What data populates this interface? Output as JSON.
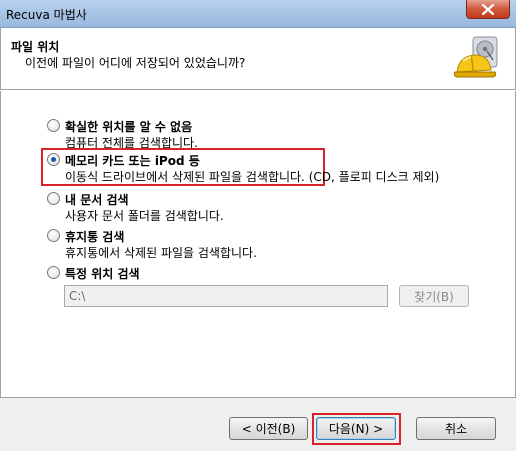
{
  "window": {
    "title": "Recuva 마법사"
  },
  "header": {
    "title": "파일 위치",
    "subtitle": "이전에 파일이 어디에 저장되어 있었습니까?"
  },
  "options": [
    {
      "title": "확실한 위치를 알 수 없음",
      "desc": "컴퓨터 전체를 검색합니다.",
      "checked": false
    },
    {
      "title": "메모리 카드 또는 iPod 등",
      "desc": "이동식 드라이브에서 삭제된 파일을 검색합니다. (CD, 플로피 디스크 제외)",
      "checked": true
    },
    {
      "title": "내 문서 검색",
      "desc": "사용자 문서 폴더를 검색합니다.",
      "checked": false
    },
    {
      "title": "휴지통 검색",
      "desc": "휴지통에서 삭제된 파일을 검색합니다.",
      "checked": false
    },
    {
      "title": "특정 위치 검색",
      "desc": "",
      "checked": false
    }
  ],
  "location": {
    "value": "C:\\",
    "browse_label": "찾기(B)"
  },
  "buttons": {
    "back": "< 이전(B)",
    "next": "다음(N) >",
    "cancel": "취소"
  },
  "colors": {
    "highlight": "#d8232a",
    "accent": "#1a5aa8"
  }
}
